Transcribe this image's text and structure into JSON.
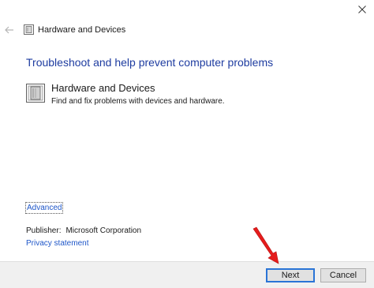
{
  "window": {
    "close_glyph": "✕"
  },
  "nav": {
    "back_icon": "back-arrow-icon",
    "title_icon": "hardware-devices-icon",
    "title": "Hardware and Devices"
  },
  "main": {
    "heading": "Troubleshoot and help prevent computer problems",
    "item": {
      "icon": "hardware-devices-icon",
      "title": "Hardware and Devices",
      "description": "Find and fix problems with devices and hardware."
    },
    "advanced_label": "Advanced",
    "publisher_label": "Publisher:",
    "publisher_value": "Microsoft Corporation",
    "privacy_label": "Privacy statement"
  },
  "footer": {
    "next_label": "Next",
    "cancel_label": "Cancel"
  },
  "colors": {
    "heading": "#1e3ca0",
    "link": "#1e56c8",
    "footer_bg": "#f0f0f0",
    "focus_border": "#2a74d6",
    "annotation_arrow": "#e51c1c"
  }
}
